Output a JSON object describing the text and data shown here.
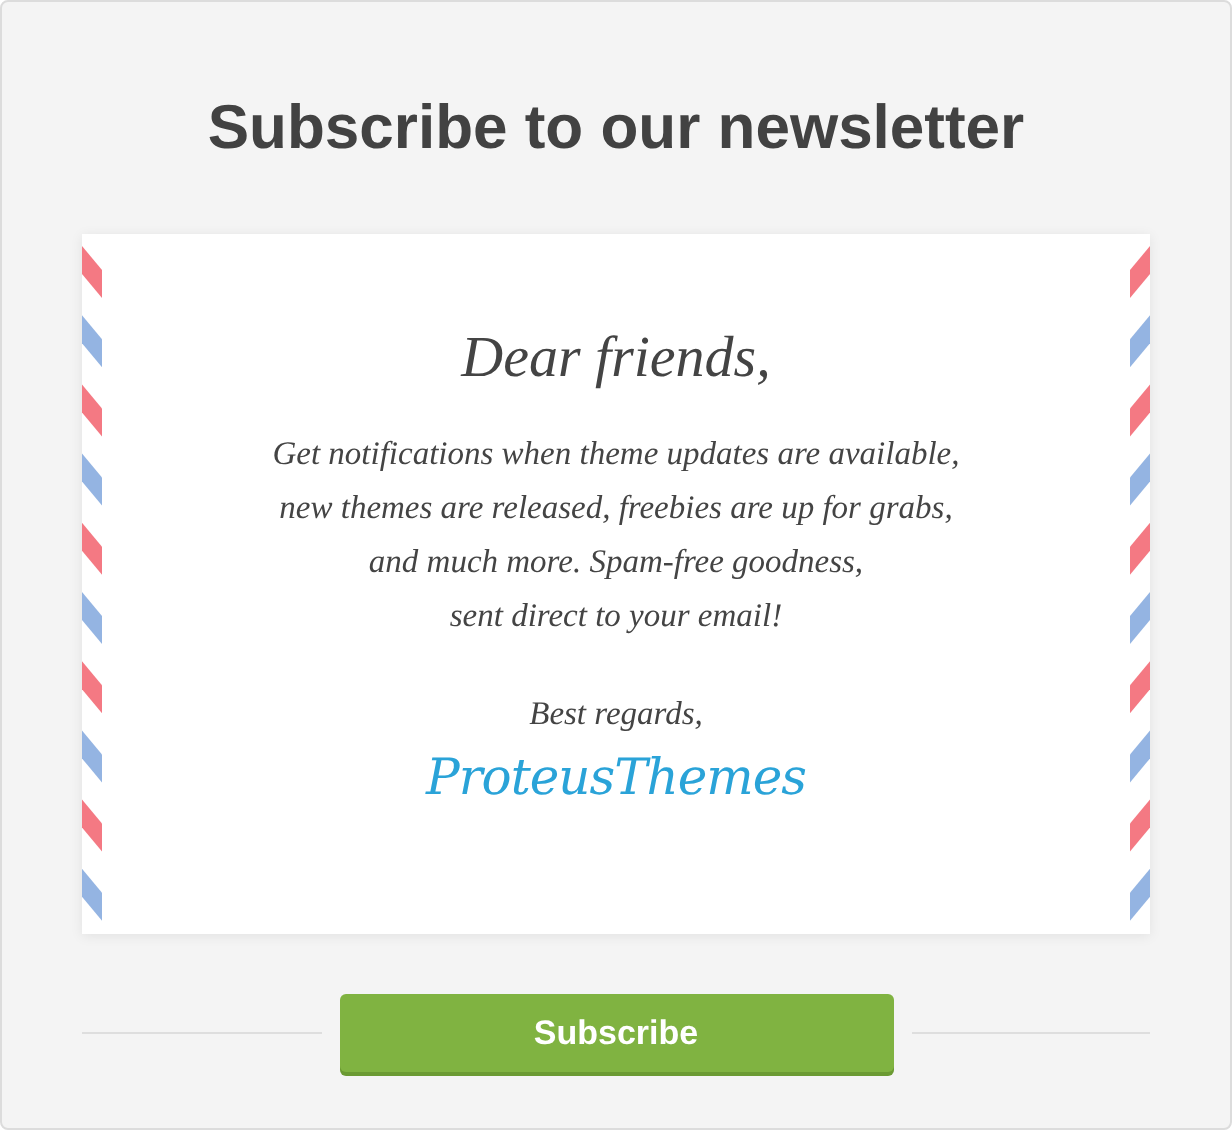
{
  "title": "Subscribe to our newsletter",
  "letter": {
    "greeting": "Dear friends,",
    "body": [
      "Get notifications when theme updates are available,",
      "new themes are released, freebies are up for grabs,",
      "and much more. Spam-free goodness,",
      "sent direct to your email!"
    ],
    "closing": "Best regards,",
    "signature": "ProteusThemes"
  },
  "button": {
    "label": "Subscribe"
  }
}
